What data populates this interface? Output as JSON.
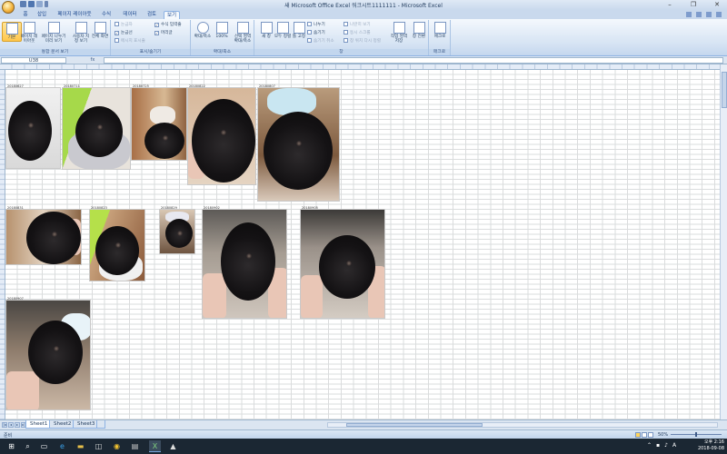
{
  "window": {
    "title": "새 Microsoft Office Excel 워크시트1111111 - Microsoft Excel",
    "controls": [
      "–",
      "❐",
      "✕"
    ]
  },
  "tabs": [
    "홈",
    "삽입",
    "페이지 레이아웃",
    "수식",
    "데이터",
    "검토",
    "보기"
  ],
  "active_tab": "보기",
  "ribbon": {
    "groups": {
      "workbook_views": "통합 문서 보기",
      "show_hide": "표시/숨기기",
      "zoom": "확대/축소",
      "window": "창",
      "macros": "매크로"
    },
    "buttons": {
      "normal": "기본",
      "page_layout": "페이지 레이아웃",
      "page_break": "페이지 나누기 미리 보기",
      "custom_views": "사용자 지정 보기",
      "full_screen": "전체 화면",
      "zoom": "확대/축소",
      "zoom_100": "100%",
      "zoom_selection": "선택 영역 확대/축소",
      "new_window": "새 창",
      "arrange_all": "모두 정렬",
      "freeze_panes": "틀 고정",
      "save_workspace": "작업 영역 저장",
      "switch_windows": "창 전환",
      "macros": "매크로"
    },
    "checks": {
      "ruler": "눈금자",
      "gridlines": "눈금선",
      "message_bar": "메시지 표시줄",
      "formula_bar": "수식 입력줄",
      "headings": "머리글"
    },
    "window_small": {
      "split": "나누기",
      "hide": "숨기기",
      "unhide": "숨기기 취소",
      "side_by_side": "나란히 보기",
      "sync_scroll": "동시 스크롤",
      "reset_position": "창 위치 다시 정렬"
    }
  },
  "formula_bar": {
    "name_box": "U38",
    "fx": "fx",
    "value": ""
  },
  "photos": {
    "stamps": [
      "20180627",
      "20180711",
      "20180725",
      "20180822",
      "20180807",
      "20180831",
      "20180823",
      "20180829",
      "20180902",
      "20180905",
      "20180907"
    ]
  },
  "sheet_tabs": [
    "Sheet1",
    "Sheet2",
    "Sheet3"
  ],
  "active_sheet": "Sheet1",
  "status": {
    "ready": "준비",
    "zoom": "50%"
  },
  "taskbar": {
    "time": "오후 2:16",
    "date": "2018-09-08",
    "ime": "A"
  }
}
